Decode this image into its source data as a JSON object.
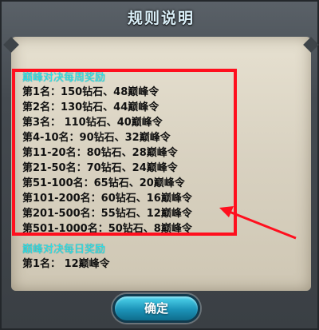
{
  "dialog": {
    "title": "规则说明"
  },
  "weekly": {
    "title": "巅峰对决每周奖励",
    "rows": [
      "第1名：150钻石、48巅峰令",
      "第2名：130钻石、44巅峰令",
      "第3名： 110钻石、40巅峰令",
      "第4-10名：90钻石、32巅峰令",
      "第11-20名：80钻石、28巅峰令",
      "第21-50名：70钻石、24巅峰令",
      "第51-100名：65钻石、20巅峰令",
      "第101-200名：60钻石、16巅峰令",
      "第201-500名：55钻石、12巅峰令",
      "第501-1000名：50钻石、8巅峰令"
    ]
  },
  "daily": {
    "title": "巅峰对决每日奖励",
    "rows": [
      "第1名： 12巅峰令"
    ]
  },
  "confirm_label": "确定",
  "colors": {
    "highlight": "#ff0f1e",
    "section_title": "#27e7f0"
  }
}
